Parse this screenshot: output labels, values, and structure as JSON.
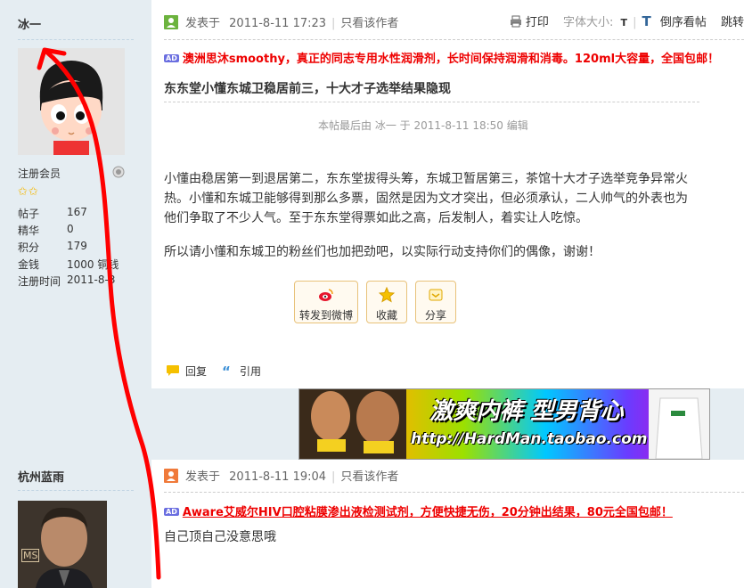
{
  "post1": {
    "author": "冰一",
    "group": "注册会员",
    "stars": "✩✩",
    "stats": [
      {
        "label": "帖子",
        "value": "167"
      },
      {
        "label": "精华",
        "value": "0"
      },
      {
        "label": "积分",
        "value": "179"
      },
      {
        "label": "金钱",
        "value": "1000 铜钱"
      },
      {
        "label": "注册时间",
        "value": "2011-8-3"
      }
    ],
    "posted_label": "发表于",
    "posted_time": "2011-8-11 17:23",
    "only_author": "只看该作者",
    "toolbar": {
      "print": "打印",
      "font_size": "字体大小:",
      "font_t": "T",
      "font_T": "T",
      "reverse": "倒序看帖",
      "jump": "跳转"
    },
    "ad_badge": "AD",
    "ad_text": "澳洲思沐smoothy，真正的同志专用水性润滑剂，长时间保持润滑和消毒。120ml大容量，全国包邮！",
    "title": "东东堂小懂东城卫稳居前三，十大才子选举结果隐现",
    "edited_note": "本帖最后由 冰一 于 2011-8-11 18:50 编辑",
    "body": "小懂由稳居第一到退居第二，东东堂拔得头筹，东城卫暂居第三，茶馆十大才子选举竞争异常火热。小懂和东城卫能够得到那么多票，固然是因为文才突出，但必须承认，二人帅气的外表也为他们争取了不少人气。至于东东堂得票如此之高，后发制人，着实让人吃惊。",
    "body2": "所以请小懂和东城卫的粉丝们也加把劲吧，以实际行动支持你们的偶像，谢谢！",
    "share_buttons": [
      {
        "label": "转发到微博",
        "icon": "weibo-icon"
      },
      {
        "label": "收藏",
        "icon": "star-icon"
      },
      {
        "label": "分享",
        "icon": "share-icon"
      }
    ],
    "reply": "回复",
    "quote": "引用"
  },
  "banner": {
    "headline": "激爽内裤 型男背心",
    "url": "http://HardMan.taobao.com"
  },
  "post2": {
    "author": "杭州蓝雨",
    "posted_label": "发表于",
    "posted_time": "2011-8-11 19:04",
    "only_author": "只看该作者",
    "ad_badge": "AD",
    "ad_text": "Aware艾威尔HIV口腔粘膜渗出液检测试剂，方便快捷无伤，20分钟出结果，80元全国包邮！",
    "body": "自己顶自己没意思哦",
    "avatar_text": "MS"
  },
  "colors": {
    "sidebar": "#e5edf2",
    "ad_red": "#ee0000",
    "annotation_red": "#ff0000",
    "button_border": "#e8c27a"
  }
}
